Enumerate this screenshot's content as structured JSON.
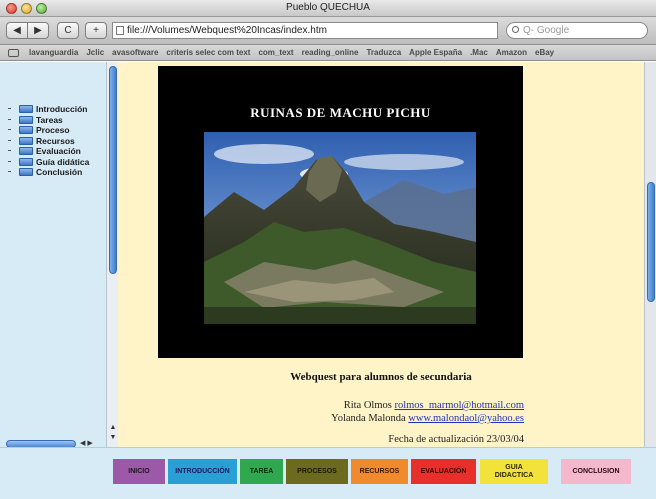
{
  "window": {
    "title": "Pueblo QUECHUA"
  },
  "toolbar": {
    "back": "◀",
    "forward": "▶",
    "reload": "C",
    "add": "+",
    "url": "file:///Volumes/Webquest%20Incas/index.htm",
    "search_placeholder": "Q- Google"
  },
  "bookmarks": [
    "lavanguardia",
    "Jclic",
    "avasoftware",
    "criteris selec com text",
    "com_text",
    "reading_online",
    "Traduzca",
    "Apple España",
    ".Mac",
    "Amazon",
    "eBay"
  ],
  "menu": {
    "items": [
      {
        "label": "Introducción"
      },
      {
        "label": "Tareas"
      },
      {
        "label": "Proceso"
      },
      {
        "label": "Recursos"
      },
      {
        "label": "Evaluación"
      },
      {
        "label": "Guía didática"
      },
      {
        "label": "Conclusión"
      }
    ]
  },
  "main": {
    "title": "RUINAS DE MACHU PICHU",
    "subtitle": "Webquest para alumnos de secundaria",
    "author1": {
      "name": "Rita Olmos",
      "email": "rolmos_marmol@hotmail.com"
    },
    "author2": {
      "name": "Yolanda Malonda",
      "email": "www.malondaol@yahoo.es"
    },
    "date": "Fecha de actualización 23/03/04"
  },
  "nav": {
    "buttons": [
      {
        "label": "INICIO",
        "color": "#9b59a8",
        "text": "#1a1a1a"
      },
      {
        "label": "INTRODUCCIÓN",
        "color": "#2a9fd6",
        "text": "#1a1a5a"
      },
      {
        "label": "TAREA",
        "color": "#2fa84f",
        "text": "#0d2a10"
      },
      {
        "label": "PROCESOS",
        "color": "#6b6a1e",
        "text": "#1a1a00"
      },
      {
        "label": "RECURSOS",
        "color": "#f08a2c",
        "text": "#3a1a00"
      },
      {
        "label": "EVALUACIÓN",
        "color": "#e8302a",
        "text": "#3a0000"
      },
      {
        "label": "GUIA DIDACTICA",
        "color": "#f2e23a",
        "text": "#2a2a00"
      },
      {
        "label": "CONCLUSION",
        "color": "#f3b8cc",
        "text": "#2a0a12"
      }
    ]
  },
  "colors": {
    "left_frame": "#d7ebf7",
    "main_frame": "#fff3c8",
    "link": "#2233bb"
  }
}
